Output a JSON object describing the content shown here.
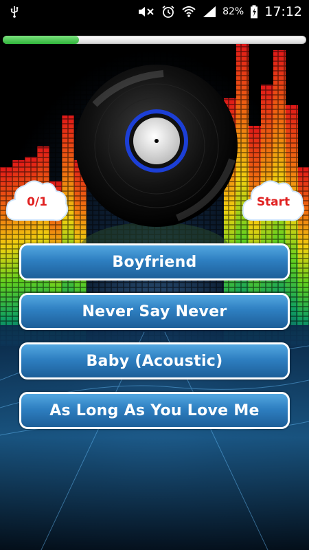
{
  "status_bar": {
    "battery": "82%",
    "time": "17:12",
    "icons": [
      "usb-icon",
      "mute-icon",
      "alarm-icon",
      "wifi-icon",
      "signal-icon",
      "battery-icon"
    ]
  },
  "game": {
    "progress": 0.25,
    "score": "0/1",
    "start_label": "Start",
    "answers": [
      "Boyfriend",
      "Never Say Never",
      "Baby (Acoustic)",
      "As Long As You Love Me"
    ]
  },
  "colors": {
    "progress_fill": "#2fb43a",
    "answer_button": "#2e7fc1",
    "cloud_text": "#e02020",
    "record_ring": "#1c3fd6"
  }
}
